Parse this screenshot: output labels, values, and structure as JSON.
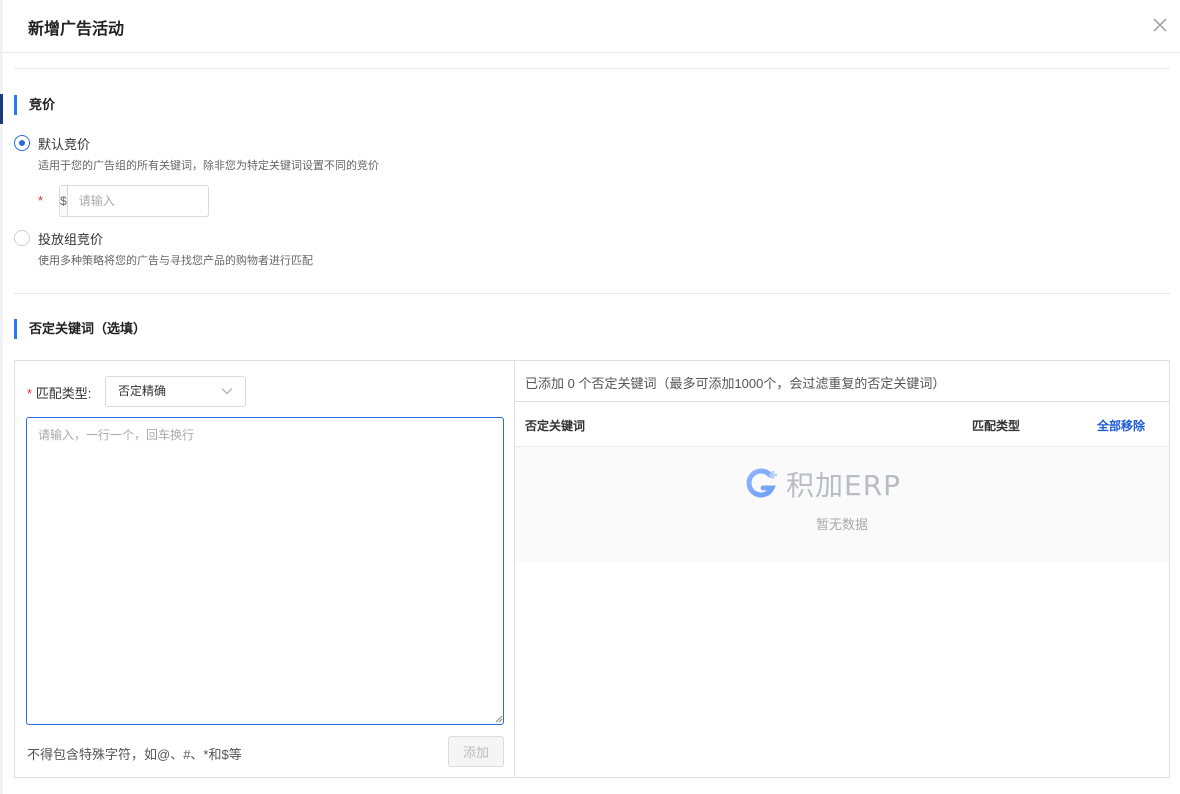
{
  "dialog": {
    "title": "新增广告活动"
  },
  "bidding": {
    "section_title": "竞价",
    "default_bid": {
      "label": "默认竞价",
      "description": "适用于您的广告组的所有关键词，除非您为特定关键词设置不同的竞价",
      "selected": true,
      "required_mark": "*",
      "currency_prefix": "$",
      "placeholder": "请输入",
      "value": ""
    },
    "group_bid": {
      "label": "投放组竞价",
      "description": "使用多种策略将您的广告与寻找您产品的购物者进行匹配",
      "selected": false
    }
  },
  "negative_keywords": {
    "section_title": "否定关键词（选填）",
    "required_mark": "*",
    "match_type_label": "匹配类型:",
    "match_type_value": "否定精确",
    "textarea_placeholder": "请输入，一行一个，回车换行",
    "hint": "不得包含特殊字符，如@、#、*和$等",
    "add_button": "添加",
    "added_summary": "已添加 0 个否定关键词（最多可添加1000个，会过滤重复的否定关键词）",
    "columns": {
      "keyword": "否定关键词",
      "match_type": "匹配类型"
    },
    "remove_all": "全部移除",
    "empty": {
      "brand": "积加ERP",
      "text": "暂无数据"
    }
  },
  "colors": {
    "accent": "#2a78ff",
    "radio_checked": "#2a6ae0",
    "link": "#1e5bd6",
    "required": "#e0302a"
  }
}
